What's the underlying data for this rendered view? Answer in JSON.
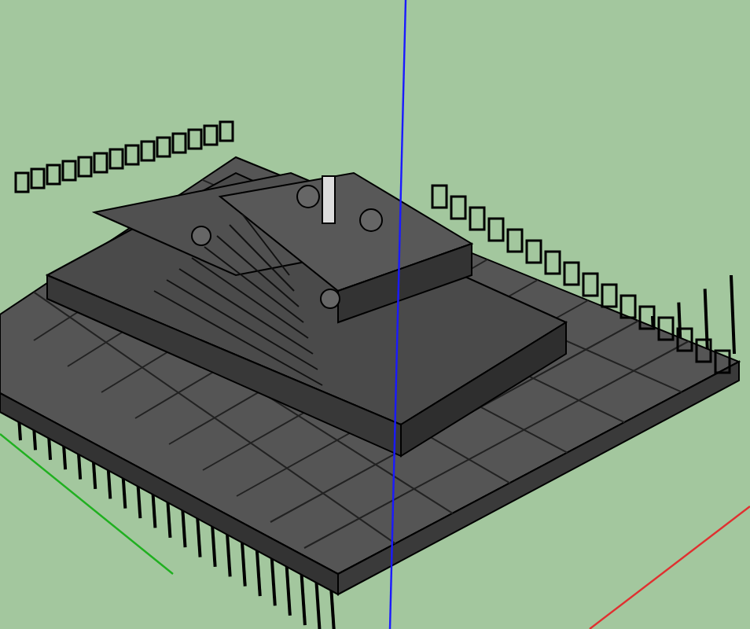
{
  "viewport": {
    "axes": [
      {
        "kind": "vertical",
        "color": "#1a1aff"
      },
      {
        "kind": "right",
        "color": "#e03030"
      },
      {
        "kind": "left",
        "color": "#20b020"
      }
    ]
  }
}
